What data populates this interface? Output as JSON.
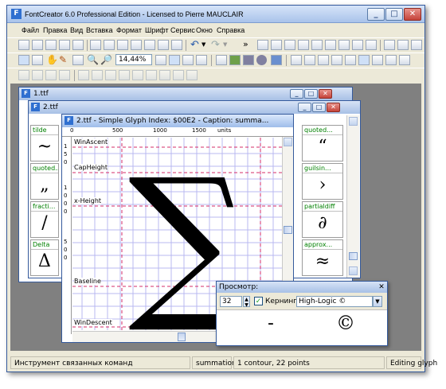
{
  "app": {
    "title": "FontCreator 6.0 Professional Edition - Licensed to Pierre MAUCLAIR",
    "icon_letter": "F"
  },
  "window_buttons": {
    "minimize": "_",
    "maximize": "□",
    "close": "✕"
  },
  "menu": [
    "Файл",
    "Правка",
    "Вид",
    "Вставка",
    "Формат",
    "Шрифт",
    "Сервис",
    "Окно",
    "Справка"
  ],
  "toolbar": {
    "zoom": "14,44%",
    "overflow": "»"
  },
  "windows": {
    "w1": {
      "title": "1.ttf"
    },
    "w2": {
      "title": "2.ttf"
    },
    "glyph": {
      "title": "2.ttf - Simple Glyph Index: $00E2 - Caption: summa..."
    }
  },
  "ruler": {
    "top_labels": [
      "0",
      "500",
      "1000",
      "1500"
    ],
    "unit": "units",
    "left_labels": [
      "1",
      "5",
      "0",
      "1",
      "0",
      "0",
      "0",
      "5",
      "0",
      "0"
    ]
  },
  "guidelines": [
    "WinAscent",
    "CapHeight",
    "x-Height",
    "Baseline",
    "WinDescent"
  ],
  "glyph_char": "∑",
  "left_cells": [
    {
      "name": "tilde",
      "glyph": "~"
    },
    {
      "name": "quoted...",
      "glyph": "„"
    },
    {
      "name": "fracti...",
      "glyph": "/"
    },
    {
      "name": "Delta",
      "glyph": "Δ"
    }
  ],
  "right_cells": [
    {
      "name": "quoted...",
      "glyph": "“"
    },
    {
      "name": "guilsin...",
      "glyph": "›"
    },
    {
      "name": "partialdiff",
      "glyph": "∂"
    },
    {
      "name": "approx...",
      "glyph": "≈"
    }
  ],
  "preview": {
    "title": "Просмотр:",
    "size": "32",
    "kerning_label": "Кернинг",
    "kerning_checked": true,
    "font_select": "High-Logic ©",
    "sample_dash": "-",
    "sample_copyright": "©"
  },
  "status": {
    "tool": "Инструмент связанных команд",
    "glyph_name": "summation",
    "contours": "1 contour, 22 points",
    "mode": "Editing glyph"
  },
  "colors": {
    "accent": "#2f6fd0",
    "guide_red": "#d62c6a",
    "grid_blue": "#8888ee",
    "cell_green": "#008000"
  }
}
